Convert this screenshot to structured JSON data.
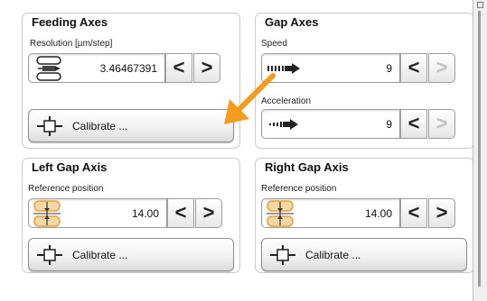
{
  "feeding_axes": {
    "title": "Feeding Axes",
    "resolution_label": "Resolution [µm/step]",
    "resolution_value": "3.46467391",
    "calibrate_label": "Calibrate ..."
  },
  "gap_axes": {
    "title": "Gap Axes",
    "speed_label": "Speed",
    "speed_value": "9",
    "acceleration_label": "Acceleration",
    "acceleration_value": "9"
  },
  "left_gap_axis": {
    "title": "Left Gap Axis",
    "reference_label": "Reference position",
    "reference_value": "14.00",
    "calibrate_label": "Calibrate ..."
  },
  "right_gap_axis": {
    "title": "Right Gap Axis",
    "reference_label": "Reference position",
    "reference_value": "14.00",
    "calibrate_label": "Calibrate ..."
  },
  "buttons": {
    "decrement": "<",
    "increment": ">"
  },
  "icons": {
    "resolution": "rollers-icon",
    "speed": "speed-arrow-icon",
    "acceleration": "acceleration-arrow-icon",
    "reference": "gap-reference-icon",
    "calibrate": "calibrate-crosshair-icon"
  },
  "colors": {
    "highlight_arrow": "#f39c1f",
    "reference_icon": "#e8a23c"
  }
}
